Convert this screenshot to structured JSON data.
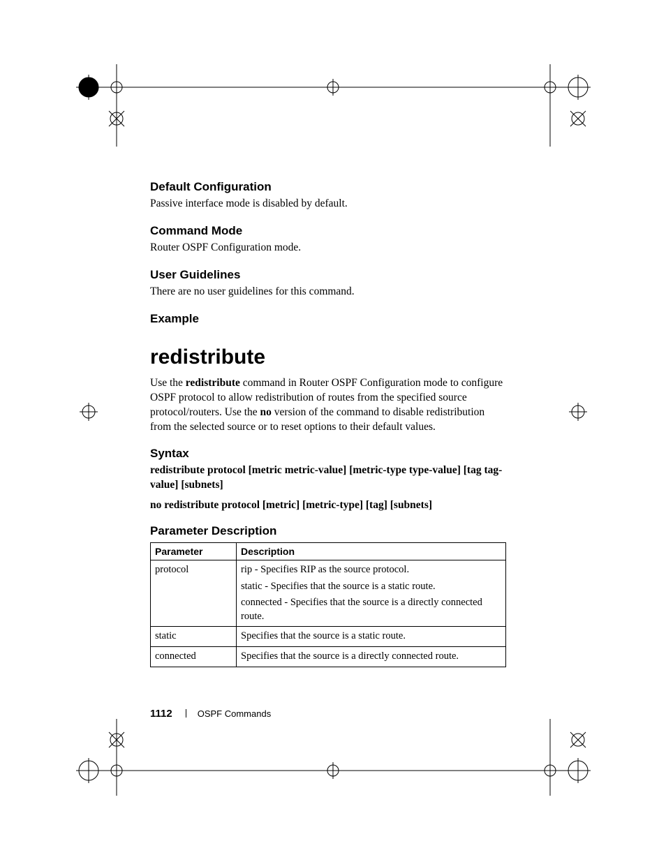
{
  "sections": {
    "default_cfg": {
      "heading": "Default Configuration",
      "body": "Passive interface mode is disabled by default."
    },
    "cmd_mode": {
      "heading": "Command Mode",
      "body": "Router OSPF Configuration mode."
    },
    "user_guide": {
      "heading": "User Guidelines",
      "body": "There are no user guidelines for this command."
    },
    "example": {
      "heading": "Example"
    }
  },
  "command": {
    "title": "redistribute",
    "desc_pre": "Use the ",
    "desc_cmd": "redistribute",
    "desc_mid1": " command in Router OSPF Configuration mode to configure OSPF protocol to allow redistribution of routes from the specified source protocol/routers. Use the ",
    "desc_no": "no",
    "desc_mid2": " version of the command to disable redistribution from the selected source or to reset options to their default values."
  },
  "syntax": {
    "heading": "Syntax",
    "line1": "redistribute protocol [metric metric-value] [metric-type type-value] [tag tag-value] [subnets]",
    "line2": "no redistribute protocol [metric] [metric-type] [tag] [subnets]"
  },
  "param_desc": {
    "heading": "Parameter Description",
    "cols": {
      "p": "Parameter",
      "d": "Description"
    },
    "rows": [
      {
        "p": "protocol",
        "d": [
          "rip - Specifies RIP as the source protocol.",
          "static - Specifies that the source is a static route.",
          "connected - Specifies that the source is a directly connected route."
        ]
      },
      {
        "p": "static",
        "d": [
          "Specifies that the source is a static route."
        ]
      },
      {
        "p": "connected",
        "d": [
          "Specifies that the source is a directly connected route."
        ]
      }
    ]
  },
  "footer": {
    "page": "1112",
    "chapter": "OSPF Commands"
  }
}
